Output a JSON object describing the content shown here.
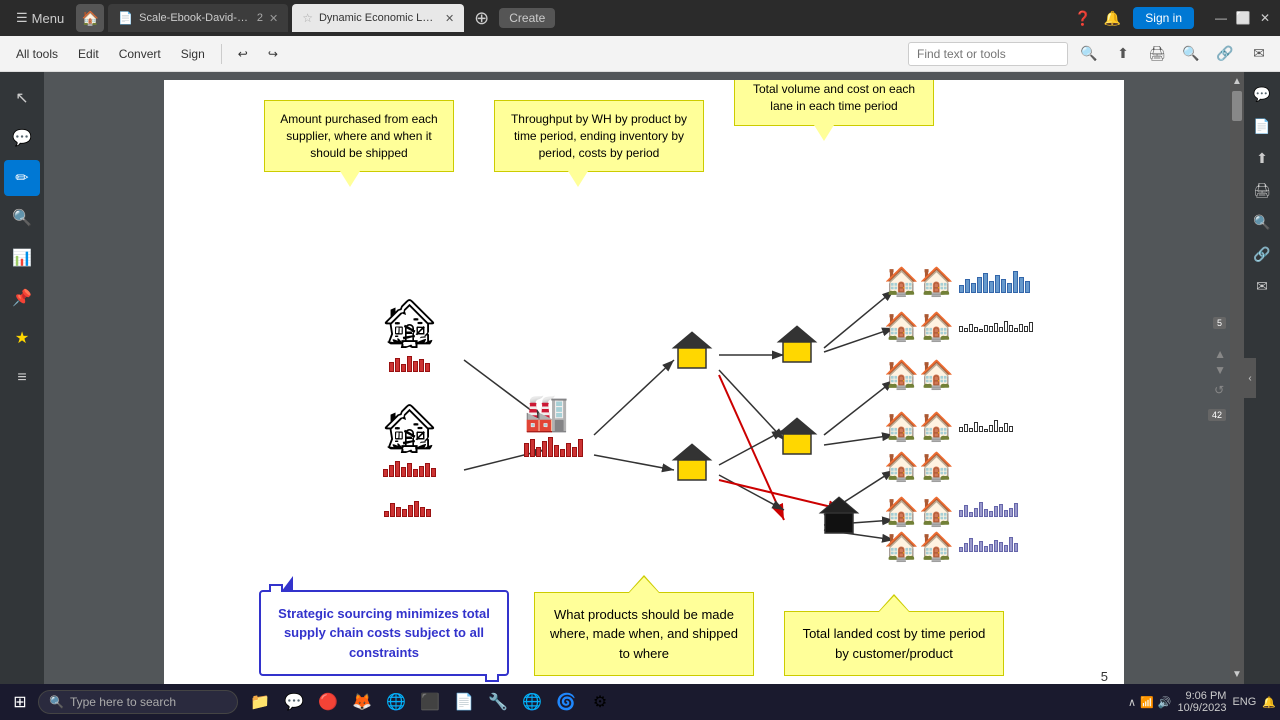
{
  "browser": {
    "menu_label": "Menu",
    "tab1_label": "Scale-Ebook-David-Finkel.pdf",
    "tab1_num": "2",
    "tab2_label": "Dynamic Economic Lot =",
    "new_tab_label": "+",
    "create_label": "Create",
    "sign_in_label": "Sign in",
    "help_icon": "?",
    "bell_icon": "🔔"
  },
  "toolbar": {
    "all_tools_label": "All tools",
    "edit_label": "Edit",
    "convert_label": "Convert",
    "sign_label": "Sign",
    "undo_label": "↩",
    "redo_label": "↪",
    "find_placeholder": "Find text or tools",
    "page_num": "5",
    "total_pages": "42"
  },
  "sidebar": {
    "icons": [
      "↖",
      "💬",
      "✏",
      "🔍",
      "📊",
      "📌",
      "⭐",
      "≡"
    ]
  },
  "right_panel": {
    "icons": [
      "💬",
      "📄",
      "⬆",
      "🖨",
      "🔍",
      "🔗",
      "✉"
    ]
  },
  "pdf": {
    "callout_top_left": "Amount purchased from each supplier, where and when it should be shipped",
    "callout_top_mid": "Throughput by WH by product by time period, ending inventory by period, costs by period",
    "callout_top_right": "Total volume and cost on each lane in each time period",
    "callout_bottom_left": "Strategic sourcing minimizes total supply chain costs subject to all constraints",
    "callout_bottom_mid": "What products should be made where, made when, and shipped to where",
    "callout_bottom_right": "Total landed cost by time period by customer/product",
    "page_number": "5"
  },
  "taskbar": {
    "search_placeholder": "Type here to search",
    "time": "9:06 PM",
    "date": "10/9/2023",
    "language": "ENG",
    "start_icon": "⊞"
  }
}
